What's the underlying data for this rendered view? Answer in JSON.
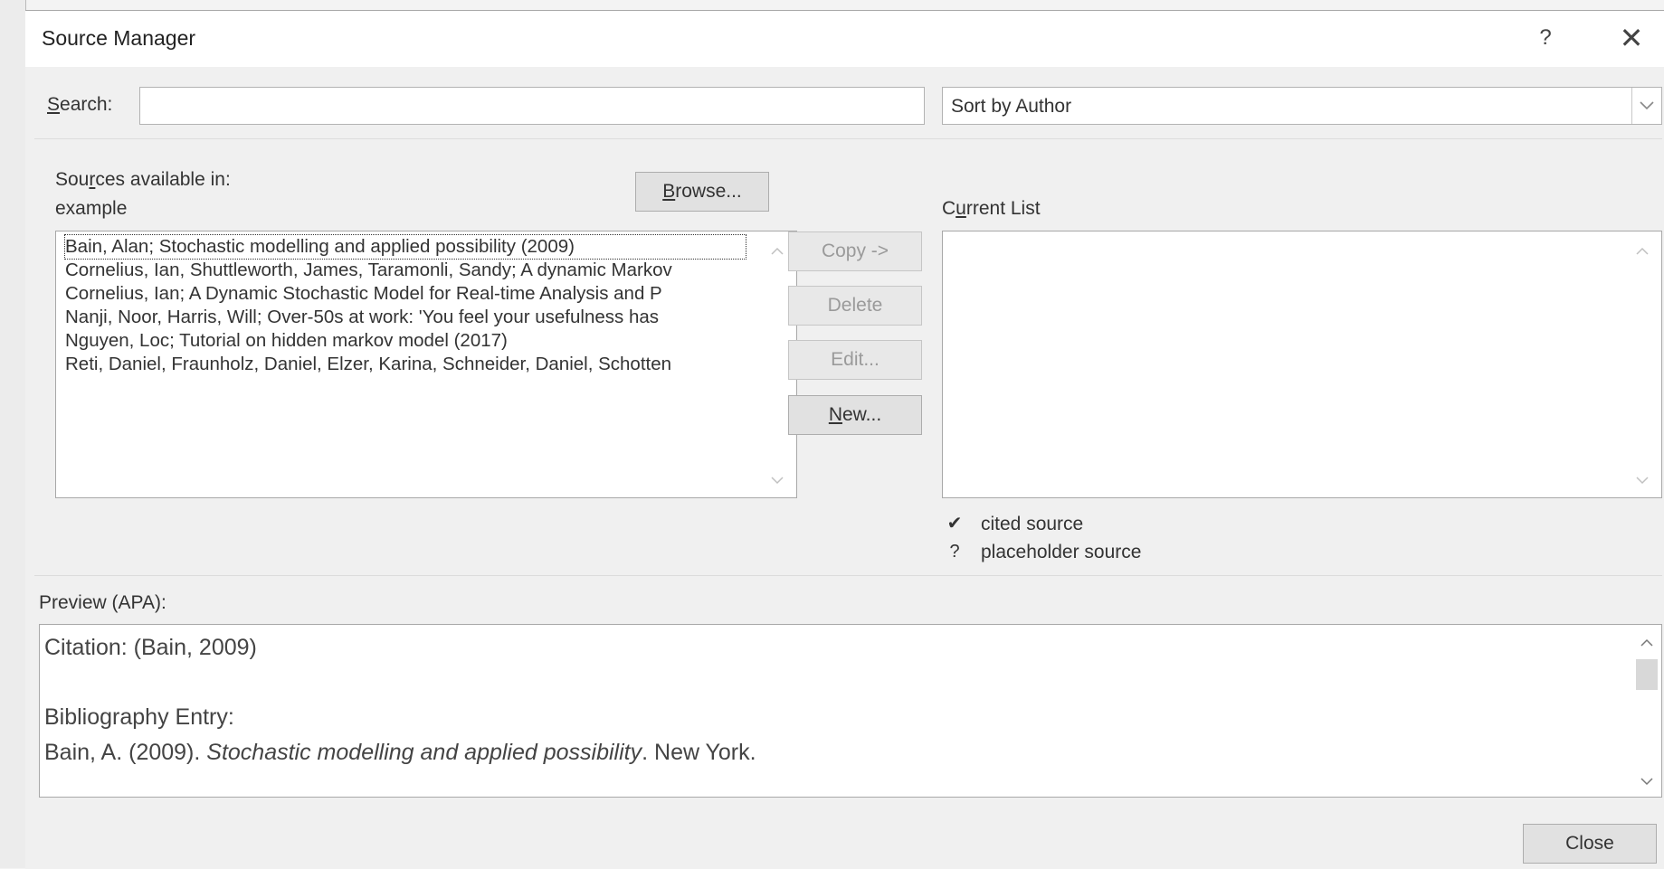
{
  "dialog": {
    "title": "Source Manager",
    "help_icon": "?",
    "close_icon": "✕"
  },
  "search": {
    "label": "Search:",
    "value": "",
    "sort_value": "Sort by Author",
    "sort_arrow_icon": "chevron-down-icon"
  },
  "sources": {
    "label_line1": "Sources available in:",
    "label_line2": "example",
    "browse_label": "Browse...",
    "items": [
      "Bain, Alan; Stochastic modelling and applied possibility (2009)",
      "Cornelius, Ian, Shuttleworth, James, Taramonli, Sandy; A dynamic Markov",
      "Cornelius, Ian; A Dynamic Stochastic Model for Real-time Analysis and P",
      "Nanji, Noor, Harris, Will; Over-50s at work: 'You feel your usefulness has",
      "Nguyen, Loc; Tutorial on hidden markov model (2017)",
      "Reti, Daniel, Fraunholz, Daniel, Elzer, Karina, Schneider, Daniel, Schotten"
    ],
    "selected_index": 0
  },
  "actions": {
    "copy_label": "Copy ->",
    "delete_label": "Delete",
    "edit_label": "Edit...",
    "new_label": "New..."
  },
  "current_list": {
    "label": "Current List",
    "items": []
  },
  "legend": {
    "cited_icon": "✔",
    "cited_label": "cited source",
    "placeholder_icon": "?",
    "placeholder_label": "placeholder source"
  },
  "preview": {
    "label": "Preview (APA):",
    "citation": "Citation:  (Bain, 2009)",
    "bibliography_heading": "Bibliography Entry:",
    "bib_author": "Bain, A. (2009). ",
    "bib_title": "Stochastic modelling and applied possibility",
    "bib_rest": ". New York."
  },
  "footer": {
    "close_label": "Close"
  }
}
